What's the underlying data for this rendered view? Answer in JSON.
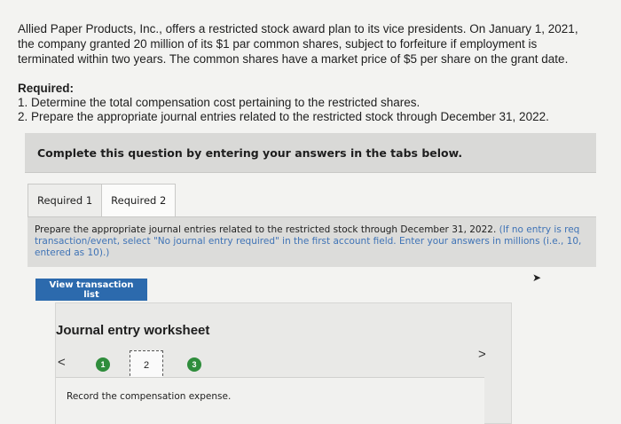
{
  "problem": {
    "text": "Allied Paper Products, Inc., offers a restricted stock award plan to its vice presidents. On January 1, 2021, the company granted 20 million of its $1 par common shares, subject to forfeiture if employment is terminated within two years. The common shares have a market price of $5 per share on the grant date."
  },
  "required": {
    "heading": "Required:",
    "item1": "1. Determine the total compensation cost pertaining to the restricted shares.",
    "item2": "2. Prepare the appropriate journal entries related to the restricted stock through December 31, 2022."
  },
  "instruction_bar": "Complete this question by entering your answers in the tabs below.",
  "tabs": [
    {
      "label": "Required 1",
      "active": false
    },
    {
      "label": "Required 2",
      "active": true
    }
  ],
  "panel": {
    "main": "Prepare the appropriate journal entries related to the restricted stock through December 31, 2022.",
    "note": "(If no entry is req transaction/event, select \"No journal entry required\" in the first account field. Enter your answers in millions (i.e., 10, entered as 10).)"
  },
  "view_button": "View transaction list",
  "worksheet": {
    "title": "Journal entry worksheet",
    "prev": "<",
    "next": ">",
    "steps": [
      "1",
      "2",
      "3"
    ],
    "record_text": "Record the compensation expense."
  },
  "colors": {
    "accent_blue": "#2c6aad",
    "step_green": "#2f8d3c",
    "note_blue": "#3f73b6"
  }
}
